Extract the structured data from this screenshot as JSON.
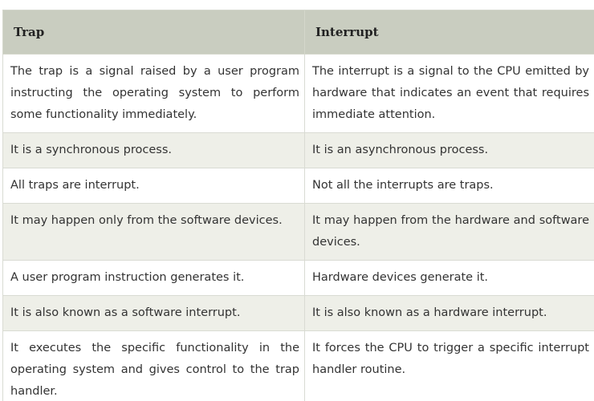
{
  "table": {
    "headers": [
      "Trap",
      "Interrupt"
    ],
    "rows": [
      [
        "The trap is a signal raised by a user program instructing the operating system to perform some functionality immediately.",
        "The interrupt is a signal to the CPU emitted by hardware that indicates an event that requires immediate attention."
      ],
      [
        "It is a synchronous process.",
        "It is an asynchronous process."
      ],
      [
        "All traps are interrupt.",
        "Not all the interrupts are traps."
      ],
      [
        "It may happen only from the software devices.",
        "It may happen from the hardware and software devices."
      ],
      [
        "A user program instruction generates it.",
        "Hardware devices generate it."
      ],
      [
        "It is also known as a software interrupt.",
        "It is also known as a hardware interrupt."
      ],
      [
        "It executes the specific functionality in the operating system and gives control to the trap handler.",
        "It forces the CPU to trigger a specific interrupt handler routine."
      ]
    ]
  }
}
